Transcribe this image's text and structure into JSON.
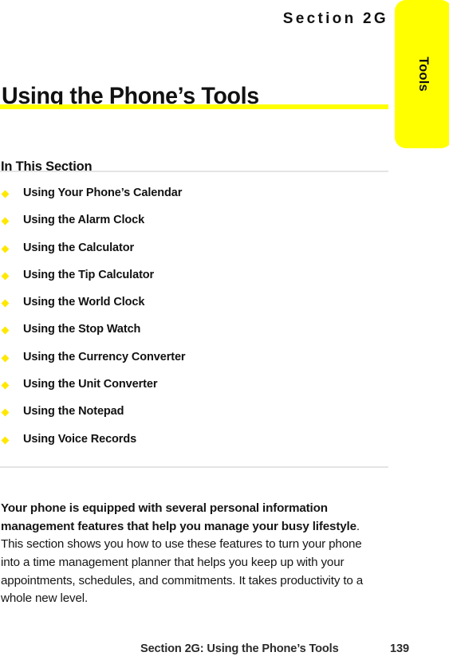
{
  "side_tab": {
    "label": "Tools",
    "background_color": "#FFFF00"
  },
  "header": {
    "eyebrow": "Section 2G",
    "title": "Using the Phone’s Tools",
    "rule_color": "#FFFF00"
  },
  "in_this_section": {
    "heading": "In This Section",
    "bullet_color": "#FFE800",
    "rule_color": "#E4E4E6",
    "items": [
      {
        "label": "Using Your Phone’s Calendar"
      },
      {
        "label": "Using the Alarm Clock"
      },
      {
        "label": "Using the Calculator"
      },
      {
        "label": "Using the Tip Calculator"
      },
      {
        "label": "Using the World Clock"
      },
      {
        "label": "Using the Stop Watch"
      },
      {
        "label": "Using the Currency Converter"
      },
      {
        "label": "Using the Unit Converter"
      },
      {
        "label": "Using the Notepad"
      },
      {
        "label": "Using Voice Records"
      }
    ]
  },
  "intro": {
    "lead": "Your phone is equipped with several personal information management features that help you manage your busy lifestyle",
    "rest": ". This section shows you how to use these features to turn your phone into a time management planner that helps you keep up with your appointments, schedules, and commitments. It takes productivity to a whole new level."
  },
  "footer": {
    "title": "Section 2G: Using the Phone’s Tools",
    "page_number": "139"
  }
}
